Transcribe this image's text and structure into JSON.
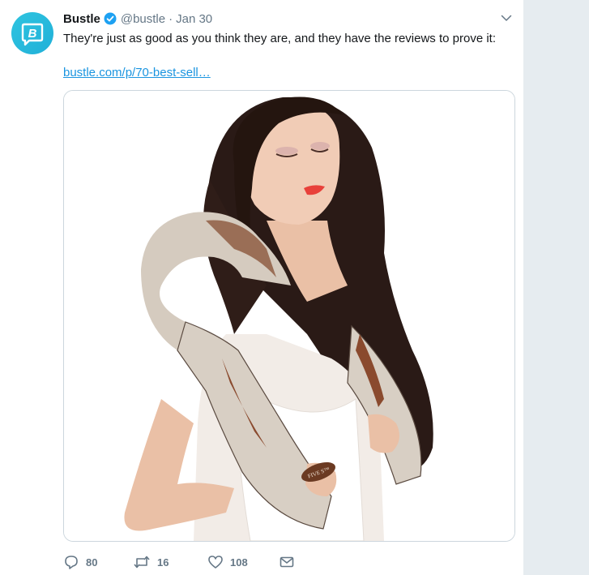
{
  "account": {
    "display_name": "Bustle",
    "handle": "@bustle",
    "separator": "·",
    "date": "Jan 30",
    "avatar_letter": "B",
    "brand_color": "#21b0d8"
  },
  "tweet": {
    "text": "They're just as good as you think they are, and they have the reviews to prove it:",
    "link_text": "bustle.com/p/70-best-sell…",
    "link_color": "#1b95e0"
  },
  "media": {
    "product_label": "FIVE S™"
  },
  "actions": {
    "reply_count": "80",
    "retweet_count": "16",
    "like_count": "108"
  },
  "icons": {
    "avatar": "bustle-logo-icon",
    "verified": "verified-badge-icon",
    "caret": "chevron-down-icon",
    "reply": "reply-icon",
    "retweet": "retweet-icon",
    "like": "heart-icon",
    "dm": "envelope-icon"
  }
}
